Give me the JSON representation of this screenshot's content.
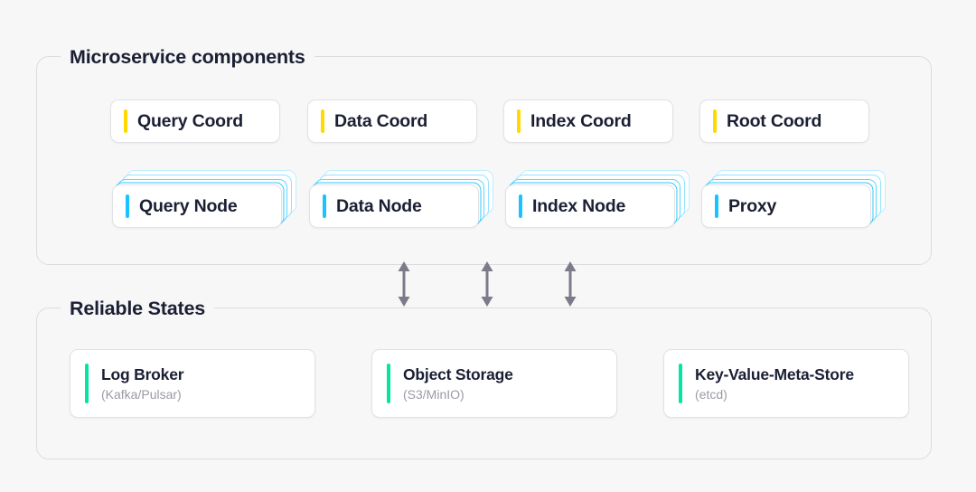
{
  "page": {
    "background_color": "#f7f7f8",
    "title": "Microservice architecture diagram"
  },
  "colors": {
    "accent_yellow": "#ffd900",
    "accent_cyan": "#19c3ff",
    "accent_green": "#04e6a0",
    "text_primary": "#1b1f33",
    "text_muted": "#9a9aa5",
    "card_border": "#e2e2e6",
    "frame_border": "#dcdcdf",
    "arrow": "#7b7b8a"
  },
  "sections": {
    "microservice": {
      "legend": "Microservice components",
      "coordinators": [
        {
          "label": "Query Coord",
          "accent": "yellow"
        },
        {
          "label": "Data Coord",
          "accent": "yellow"
        },
        {
          "label": "Index Coord",
          "accent": "yellow"
        },
        {
          "label": "Root Coord",
          "accent": "yellow"
        }
      ],
      "nodes": [
        {
          "label": "Query Node",
          "accent": "cyan",
          "stacked": true,
          "stack_layers": 4
        },
        {
          "label": "Data Node",
          "accent": "cyan",
          "stacked": true,
          "stack_layers": 4
        },
        {
          "label": "Index Node",
          "accent": "cyan",
          "stacked": true,
          "stack_layers": 4
        },
        {
          "label": "Proxy",
          "accent": "cyan",
          "stacked": true,
          "stack_layers": 4
        }
      ]
    },
    "reliable_states": {
      "legend": "Reliable States",
      "stores": [
        {
          "title": "Log Broker",
          "subtitle": "(Kafka/Pulsar)",
          "accent": "green"
        },
        {
          "title": "Object Storage",
          "subtitle": "(S3/MinIO)",
          "accent": "green"
        },
        {
          "title": "Key-Value-Meta-Store",
          "subtitle": "(etcd)",
          "accent": "green"
        }
      ]
    }
  },
  "connectors": [
    {
      "name": "connector-left",
      "type": "double-arrow-vertical"
    },
    {
      "name": "connector-middle",
      "type": "double-arrow-vertical"
    },
    {
      "name": "connector-right",
      "type": "double-arrow-vertical"
    }
  ]
}
